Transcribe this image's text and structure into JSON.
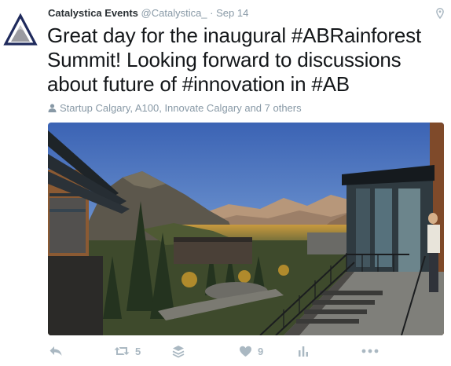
{
  "tweet": {
    "display_name": "Catalystica Events",
    "handle": "@Catalystica_",
    "separator": "·",
    "date": "Sep 14",
    "text": "Great day for the inaugural #ABRainforest Summit! Looking forward to discussions about future of #innovation in #AB",
    "tagged_people": "Startup Calgary, A100, Innovate Calgary and 7 others"
  },
  "actions": {
    "retweet_count": "5",
    "like_count": "9"
  },
  "colors": {
    "muted": "#8899a6",
    "icon": "#aab8c2",
    "text": "#14171a",
    "avatar_navy": "#1f2a5c"
  },
  "icons": [
    "catalystica-logo",
    "location-pin-icon",
    "person-icon",
    "reply-icon",
    "retweet-icon",
    "layers-icon",
    "heart-icon",
    "analytics-icon",
    "more-icon"
  ]
}
